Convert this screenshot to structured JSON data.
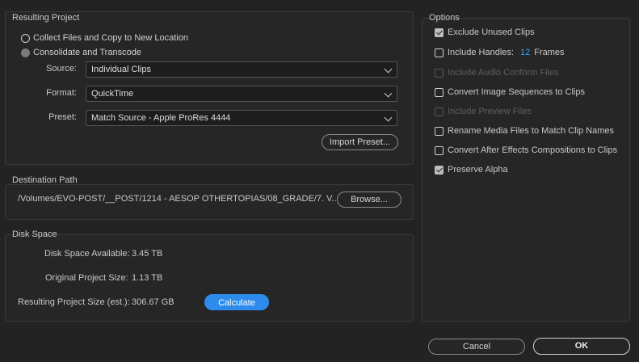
{
  "resulting_project": {
    "title": "Resulting Project",
    "option_collect": "Collect Files and Copy to New Location",
    "option_consolidate": "Consolidate and Transcode",
    "source_label": "Source:",
    "source_value": "Individual Clips",
    "format_label": "Format:",
    "format_value": "QuickTime",
    "preset_label": "Preset:",
    "preset_value": "Match Source - Apple ProRes 4444",
    "import_preset": "Import Preset..."
  },
  "destination": {
    "title": "Destination Path",
    "path": "/Volumes/EVO-POST/__POST/1214 - AESOP OTHERTOPIAS/08_GRADE/7. V...",
    "browse": "Browse..."
  },
  "disk_space": {
    "title": "Disk Space",
    "available_label": "Disk Space Available:",
    "available_value": "3.45 TB",
    "original_label": "Original Project Size:",
    "original_value": "1.13 TB",
    "resulting_label": "Resulting Project Size (est.):",
    "resulting_value": "306.67 GB",
    "calculate": "Calculate"
  },
  "options": {
    "title": "Options",
    "items": [
      {
        "label": "Exclude Unused Clips",
        "checked": true,
        "disabled": false
      },
      {
        "label": "Include Handles:",
        "checked": false,
        "disabled": false,
        "value": "12",
        "suffix": "Frames"
      },
      {
        "label": "Include Audio Conform Files",
        "checked": false,
        "disabled": true
      },
      {
        "label": "Convert Image Sequences to Clips",
        "checked": false,
        "disabled": false
      },
      {
        "label": "Include Preview Files",
        "checked": false,
        "disabled": true
      },
      {
        "label": "Rename Media Files to Match Clip Names",
        "checked": false,
        "disabled": false
      },
      {
        "label": "Convert After Effects Compositions to Clips",
        "checked": false,
        "disabled": false
      },
      {
        "label": "Preserve Alpha",
        "checked": true,
        "disabled": false
      }
    ]
  },
  "footer": {
    "cancel": "Cancel",
    "ok": "OK"
  }
}
